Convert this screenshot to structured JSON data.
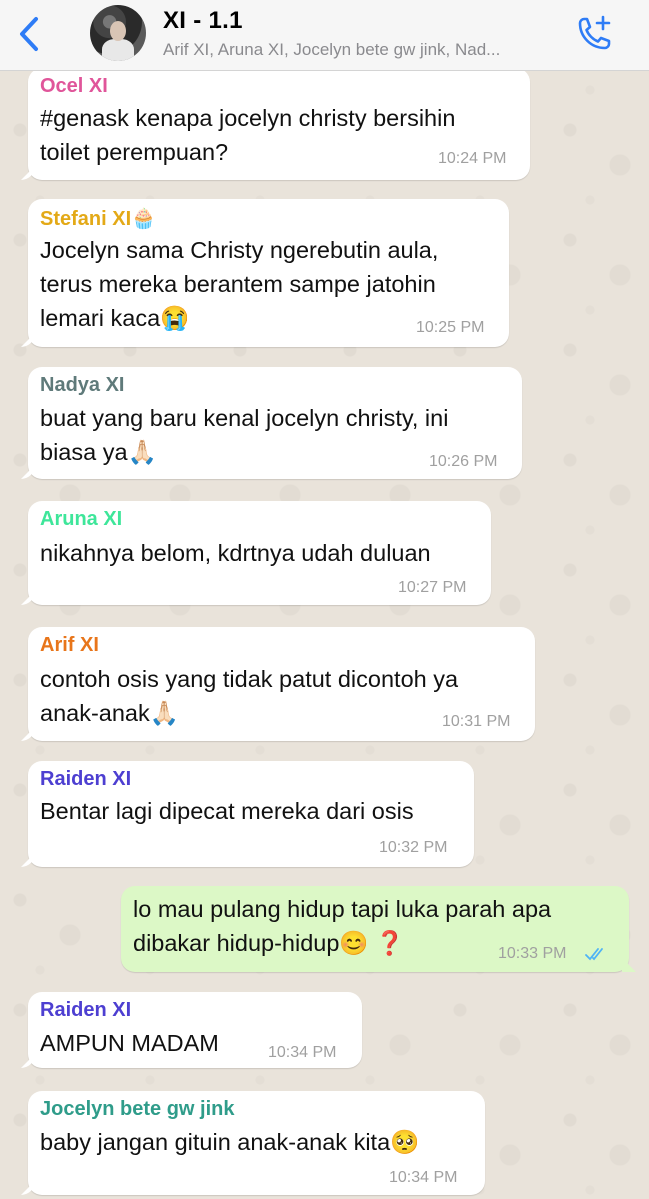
{
  "header": {
    "title": "XI - 1.1",
    "subtitle": "Arif XI, Aruna XI, Jocelyn bete gw jink, Nad...",
    "back_icon": "chevron-left-icon",
    "call_icon": "add-call-icon",
    "accent": "#2e7cf6"
  },
  "messages": [
    {
      "sender": "Ocel XI",
      "sender_color": "#e0559a",
      "text": "#genask kenapa jocelyn christy bersihin\ntoilet perempuan?",
      "time": "10:24 PM"
    },
    {
      "sender": "Stefani XI🧁",
      "sender_color": "#e3a917",
      "text": "Jocelyn sama Christy ngerebutin aula,\nterus mereka berantem sampe jatohin\nlemari kaca😭",
      "time": "10:25 PM"
    },
    {
      "sender": "Nadya XI",
      "sender_color": "#5f7a7a",
      "text": "buat yang baru kenal jocelyn christy, ini\nbiasa ya🙏🏻",
      "time": "10:26 PM"
    },
    {
      "sender": "Aruna XI",
      "sender_color": "#3ee69a",
      "text": "nikahnya belom, kdrtnya udah duluan",
      "time": "10:27 PM"
    },
    {
      "sender": "Arif XI",
      "sender_color": "#e8751a",
      "text": "contoh osis yang tidak patut dicontoh ya\nanak-anak🙏🏻",
      "time": "10:31 PM"
    },
    {
      "sender": "Raiden XI",
      "sender_color": "#4d3fd1",
      "text": "Bentar lagi dipecat mereka dari osis",
      "time": "10:32 PM"
    },
    {
      "sender": "",
      "sender_color": "",
      "text": "lo mau pulang hidup tapi luka parah apa\ndibakar hidup-hidup😊 ❓",
      "time": "10:33 PM"
    },
    {
      "sender": "Raiden XI",
      "sender_color": "#4d3fd1",
      "text": "AMPUN MADAM",
      "time": "10:34 PM"
    },
    {
      "sender": "Jocelyn bete gw jink",
      "sender_color": "#2f9c8a",
      "text": "baby jangan gituin anak-anak kita🥺",
      "time": "10:34 PM"
    }
  ],
  "read_tick_color": "#4fb3f6"
}
